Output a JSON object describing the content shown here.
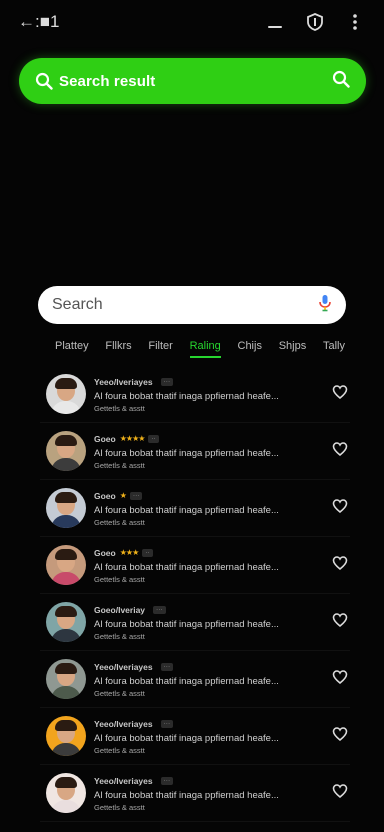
{
  "topbar": {
    "back_label": "←:■1",
    "icons": [
      "back-icon",
      "minimize-icon",
      "shield-icon",
      "more-vertical-icon"
    ]
  },
  "green_search": {
    "label": "Search result",
    "accent": "#2fcf14"
  },
  "search": {
    "placeholder": "Search"
  },
  "tabs": {
    "items": [
      "Plattey",
      "Fllkrs",
      "Filter",
      "Raling",
      "Chijs",
      "Shjps",
      "Tally"
    ],
    "active": "Raling"
  },
  "list": {
    "rows": [
      {
        "name": "Yeeo/Iveriayes",
        "stars": "",
        "tag": "···",
        "desc": "Al foura bobat thatif inaga ppfiernad heafe...",
        "sub": "Gettetls & asstt",
        "avatar_bg": "#d9d9d9",
        "shirt": "#e8e8e8"
      },
      {
        "name": "Goeo",
        "stars": "★★★★",
        "tag": "··",
        "desc": "Al foura bobat thatif inaga ppfiernad heafe...",
        "sub": "Gettetls & asstt",
        "avatar_bg": "#b9a27f",
        "shirt": "#3c3c3c"
      },
      {
        "name": "Goeo",
        "stars": "★",
        "tag": "···",
        "desc": "Al foura bobat thatif inaga ppfiernad heafe...",
        "sub": "Gettetls & asstt",
        "avatar_bg": "#c4cbd4",
        "shirt": "#283a5c"
      },
      {
        "name": "Goeo",
        "stars": "★★★",
        "tag": "··",
        "desc": "Al foura bobat thatif inaga ppfiernad heafe...",
        "sub": "Gettetls & asstt",
        "avatar_bg": "#c59a7c",
        "shirt": "#c84a6a"
      },
      {
        "name": "Goeo/Iveriay",
        "stars": "",
        "tag": "···",
        "desc": "Al foura bobat thatif inaga ppfiernad heafe...",
        "sub": "Gettetls & asstt",
        "avatar_bg": "#7fa5a6",
        "shirt": "#2d3640"
      },
      {
        "name": "Yeeo/Iveriayes",
        "stars": "",
        "tag": "···",
        "desc": "Al foura bobat thatif inaga ppfiernad heafe...",
        "sub": "Gettetls & asstt",
        "avatar_bg": "#8f9892",
        "shirt": "#4d5a4c"
      },
      {
        "name": "Yeeo/Iveriayes",
        "stars": "",
        "tag": "···",
        "desc": "Al foura bobat thatif inaga ppfiernad heafe...",
        "sub": "Gettetls & asstt",
        "avatar_bg": "#f2a41d",
        "shirt": "#3b3b3b"
      },
      {
        "name": "Yeeo/Iveriayes",
        "stars": "",
        "tag": "···",
        "desc": "Al foura bobat thatif inaga ppfiernad heafe...",
        "sub": "Gettetls & asstt",
        "avatar_bg": "#f0e6e2",
        "shirt": "#e9dede"
      }
    ]
  }
}
